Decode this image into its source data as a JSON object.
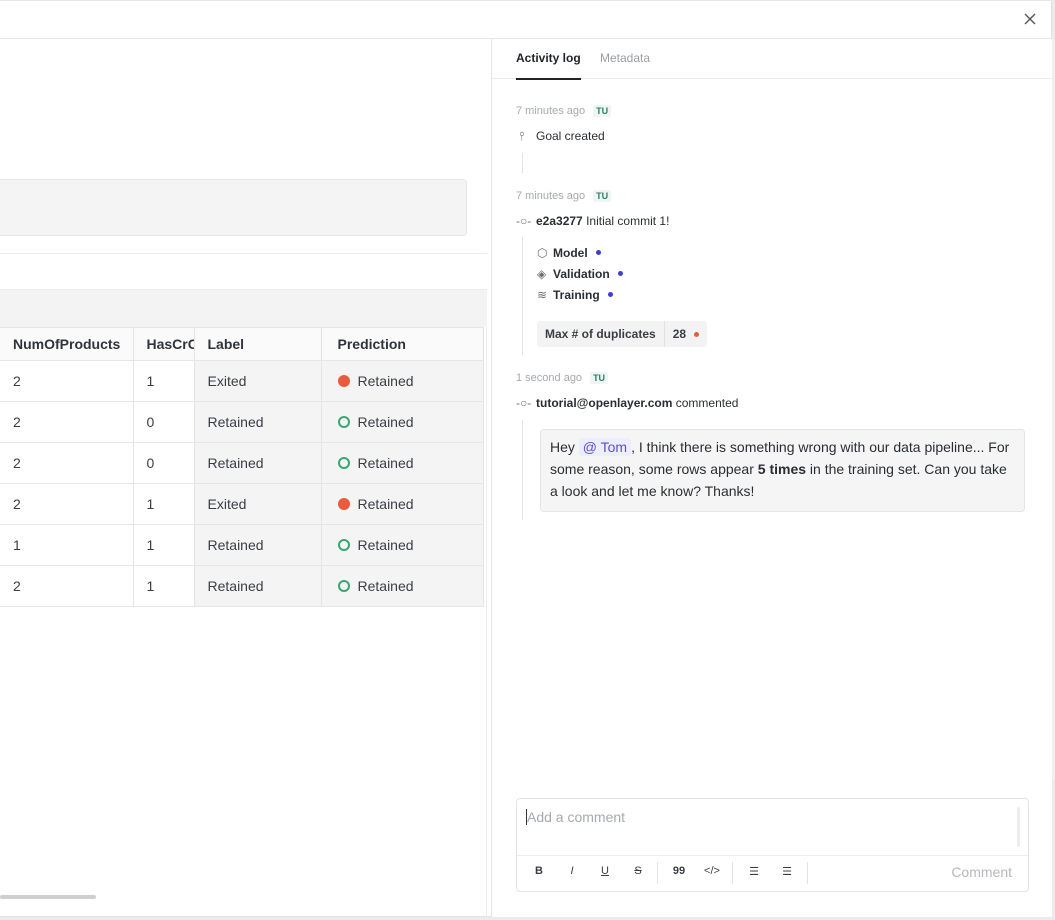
{
  "header": {
    "close_icon": "close-icon"
  },
  "table": {
    "columns": [
      "NumOfProducts",
      "HasCrCard",
      "Label",
      "Prediction"
    ],
    "rows": [
      {
        "num": "2",
        "hascr": "1",
        "label": "Exited",
        "pred": "Retained",
        "pred_style": "filled"
      },
      {
        "num": "2",
        "hascr": "0",
        "label": "Retained",
        "pred": "Retained",
        "pred_style": "open"
      },
      {
        "num": "2",
        "hascr": "0",
        "label": "Retained",
        "pred": "Retained",
        "pred_style": "open"
      },
      {
        "num": "2",
        "hascr": "1",
        "label": "Exited",
        "pred": "Retained",
        "pred_style": "filled"
      },
      {
        "num": "1",
        "hascr": "1",
        "label": "Retained",
        "pred": "Retained",
        "pred_style": "open"
      },
      {
        "num": "2",
        "hascr": "1",
        "label": "Retained",
        "pred": "Retained",
        "pred_style": "open"
      }
    ]
  },
  "panel": {
    "tabs": {
      "activity": "Activity log",
      "metadata": "Metadata"
    },
    "events": [
      {
        "time": "7 minutes ago",
        "badge": "TU",
        "text": "Goal created"
      },
      {
        "time": "7 minutes ago",
        "badge": "TU",
        "commit_hash": "e2a3277",
        "commit_msg": "Initial commit 1!"
      },
      {
        "time": "1 second ago",
        "badge": "TU",
        "author": "tutorial@openlayer.com",
        "action": "commented"
      }
    ],
    "commit_items": [
      "Model",
      "Validation",
      "Training"
    ],
    "metric": {
      "label": "Max # of duplicates",
      "value": "28"
    },
    "comment": {
      "prefix": "Hey",
      "mention": "@ Tom",
      "text_a": ", I think there is something wrong with our data pipeline... For some reason, some rows appear ",
      "bold": "5 times",
      "text_b": " in the training set. Can you take a look and let me know? Thanks!"
    },
    "editor": {
      "placeholder": "Add a comment",
      "tools": [
        "B",
        "I",
        "U",
        "S",
        "99",
        "</>",
        "ordered-list",
        "bullet-list"
      ],
      "submit": "Comment"
    }
  },
  "colors": {
    "accent": "#3b3fd8",
    "failed": "#ea5a3c",
    "passed": "#3aa673"
  }
}
